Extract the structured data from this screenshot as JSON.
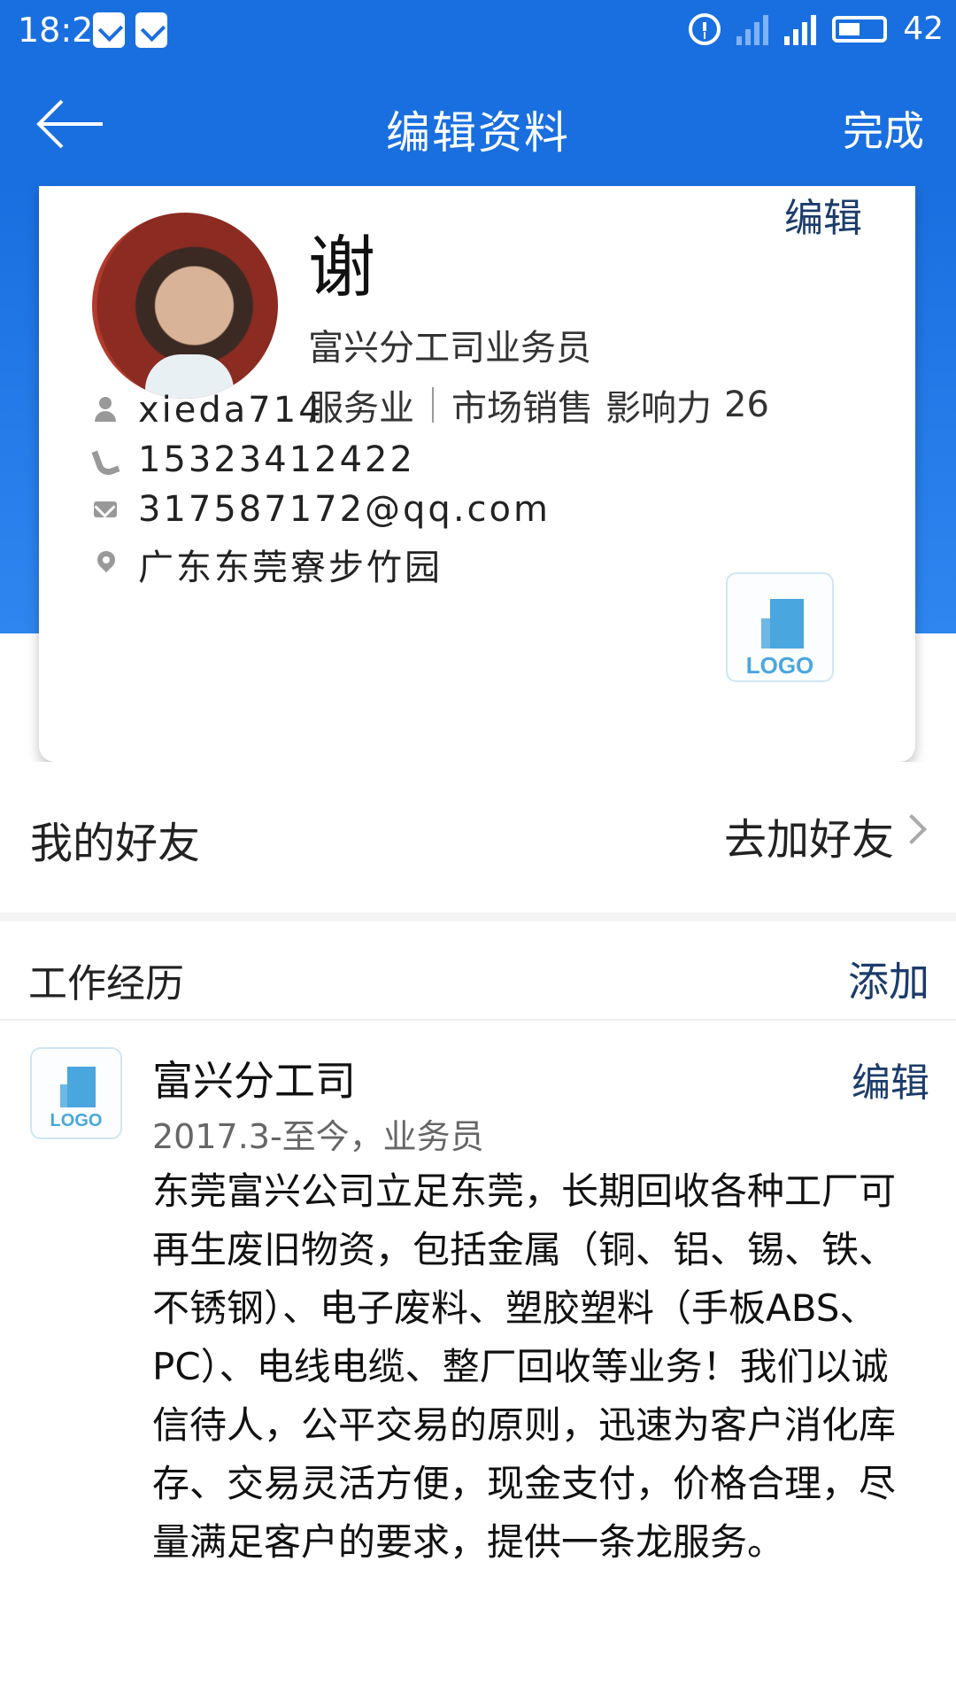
{
  "status_bar": {
    "time": "18:20",
    "battery_level": "42"
  },
  "nav": {
    "title": "编辑资料",
    "done_label": "完成"
  },
  "profile": {
    "edit_label": "编辑",
    "name": "谢",
    "title": "富兴分工司业务员",
    "industry": "服务业",
    "field": "市场销售",
    "influence_label": "影响力",
    "influence_value": "26",
    "username": "xieda714",
    "phone": "15323412422",
    "email": "317587172@qq.com",
    "location": "广东东莞寮步竹园",
    "logo_text": "LOGO"
  },
  "friends": {
    "label": "我的好友",
    "action_label": "去加好友"
  },
  "work": {
    "section_title": "工作经历",
    "add_label": "添加",
    "items": [
      {
        "company": "富兴分工司",
        "edit_label": "编辑",
        "period": "2017.3-至今，业务员",
        "description": "东莞富兴公司立足东莞，长期回收各种工厂可再生废旧物资，包括金属（铜、铝、锡、铁、不锈钢）、电子废料、塑胶塑料（手板ABS、PC）、电线电缆、整厂回收等业务！我们以诚信待人，公平交易的原则，迅速为客户消化库存、交易灵活方便，现金支付，价格合理，尽量满足客户的要求，提供一条龙服务。",
        "logo_text": "LOGO"
      }
    ]
  },
  "colors": {
    "brand_blue": "#1a6fe0",
    "link_dark": "#1c3c6b",
    "logo_blue": "#4aa6df"
  }
}
